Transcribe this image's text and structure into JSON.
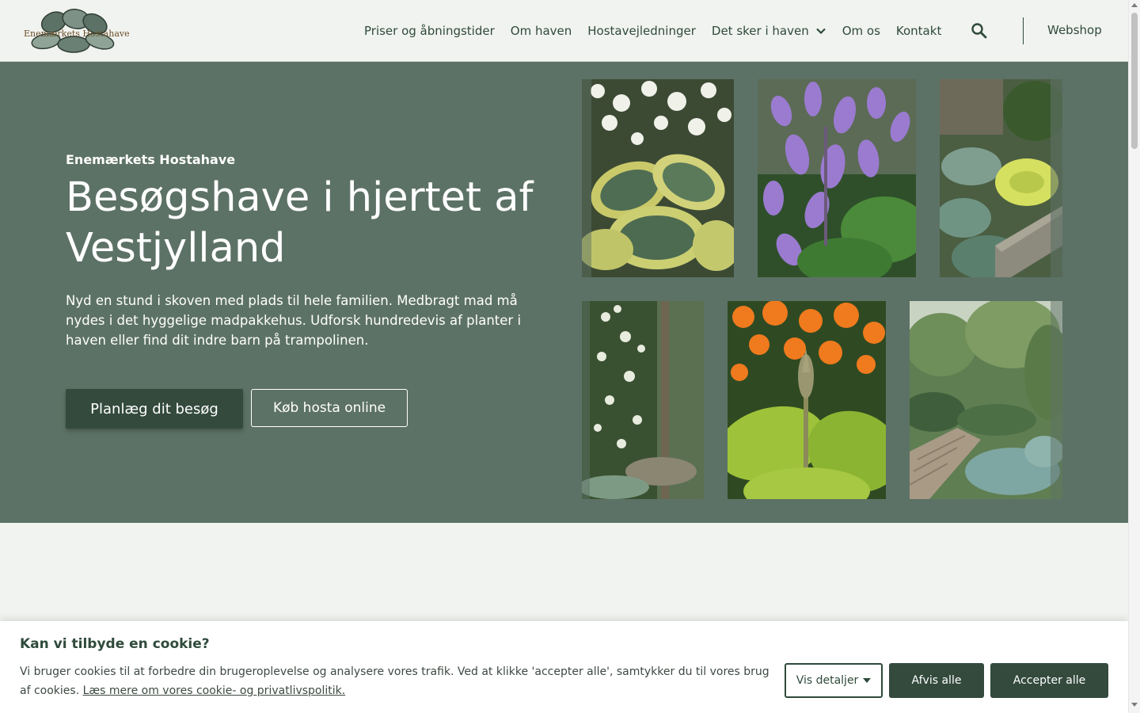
{
  "header": {
    "logo_text": "Enemærkets Hostahave",
    "nav": [
      {
        "label": "Priser og åbningstider"
      },
      {
        "label": "Om haven"
      },
      {
        "label": "Hostavejledninger"
      },
      {
        "label": "Det sker i haven"
      },
      {
        "label": "Om os"
      },
      {
        "label": "Kontakt"
      }
    ],
    "search_icon": "search-icon",
    "webshop_label": "Webshop"
  },
  "hero": {
    "eyebrow": "Enemærkets Hostahave",
    "title": "Besøgshave i hjertet af Vestjylland",
    "description": "Nyd en stund i skoven med plads til hele familien. Medbragt mad må nydes i det hyggelige madpakkehus. Udforsk hundredevis af planter i haven eller find dit indre barn på trampolinen.",
    "primary_button": "Planlæg dit besøg",
    "secondary_button": "Køb hosta online",
    "background_color": "#5d7266"
  },
  "cookie": {
    "title": "Kan vi tilbyde en cookie?",
    "text": "Vi bruger cookies til at forbedre din brugeroplevelse og analysere vores trafik. Ved at klikke 'accepter alle', samtykker du til vores brug af cookies.",
    "link_text": "Læs mere om vores cookie- og privatlivspolitik.",
    "details_button": "Vis detaljer",
    "decline_button": "Afvis alle",
    "accept_button": "Accepter alle"
  },
  "colors": {
    "accent": "#334a3d",
    "background": "#f1f3f0"
  }
}
